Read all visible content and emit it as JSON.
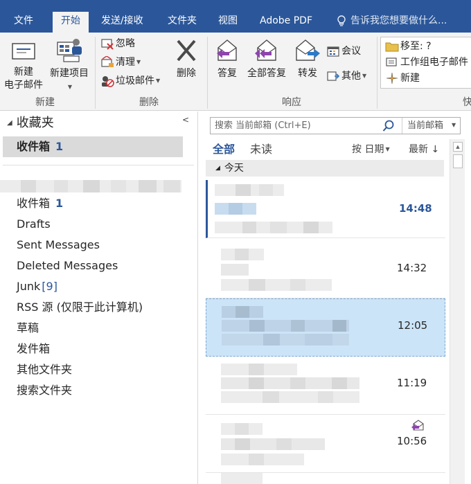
{
  "tabs": {
    "file": "文件",
    "home": "开始",
    "send_receive": "发送/接收",
    "folder": "文件夹",
    "view": "视图",
    "adobe_pdf": "Adobe PDF",
    "tell_me": "告诉我您想要做什么..."
  },
  "ribbon": {
    "new_email_line1": "新建",
    "new_email_line2": "电子邮件",
    "new_items": "新建项目",
    "ignore": "忽略",
    "cleanup": "清理",
    "junk": "垃圾邮件",
    "delete": "删除",
    "reply": "答复",
    "reply_all": "全部答复",
    "forward": "转发",
    "meeting": "会议",
    "more": "其他",
    "move_to": "移至: ?",
    "team_email": "工作组电子邮件",
    "quick_new": "新建",
    "group_new": "新建",
    "group_delete": "删除",
    "group_respond": "响应",
    "group_quick_partial": "快"
  },
  "folder_pane": {
    "favorites": "收藏夹",
    "fav_inbox": "收件箱",
    "fav_inbox_count": "1",
    "folders": [
      {
        "label": "收件箱",
        "count": "1"
      },
      {
        "label": "Drafts",
        "count": ""
      },
      {
        "label": "Sent Messages",
        "count": ""
      },
      {
        "label": "Deleted Messages",
        "count": ""
      },
      {
        "label": "Junk",
        "count": "[9]"
      },
      {
        "label": "RSS 源 (仅限于此计算机)",
        "count": ""
      },
      {
        "label": "草稿",
        "count": ""
      },
      {
        "label": "发件箱",
        "count": ""
      },
      {
        "label": "其他文件夹",
        "count": ""
      },
      {
        "label": "搜索文件夹",
        "count": ""
      }
    ]
  },
  "message_list": {
    "search_placeholder": "搜索 当前邮箱 (Ctrl+E)",
    "search_scope": "当前邮箱",
    "filter_all": "全部",
    "filter_unread": "未读",
    "sort_by": "按 日期",
    "sort_order": "最新 ↓",
    "group_today": "今天",
    "messages": [
      {
        "time": "14:48",
        "unread": true,
        "selected": false
      },
      {
        "time": "14:32",
        "unread": false,
        "selected": false
      },
      {
        "time": "12:05",
        "unread": false,
        "selected": true
      },
      {
        "time": "11:19",
        "unread": false,
        "selected": false
      },
      {
        "time": "10:56",
        "unread": false,
        "selected": false,
        "replied": true
      }
    ]
  },
  "colors": {
    "accent": "#2b579a",
    "ribbon_bg": "#f3f3f3",
    "selected_row": "#cce4f7"
  }
}
